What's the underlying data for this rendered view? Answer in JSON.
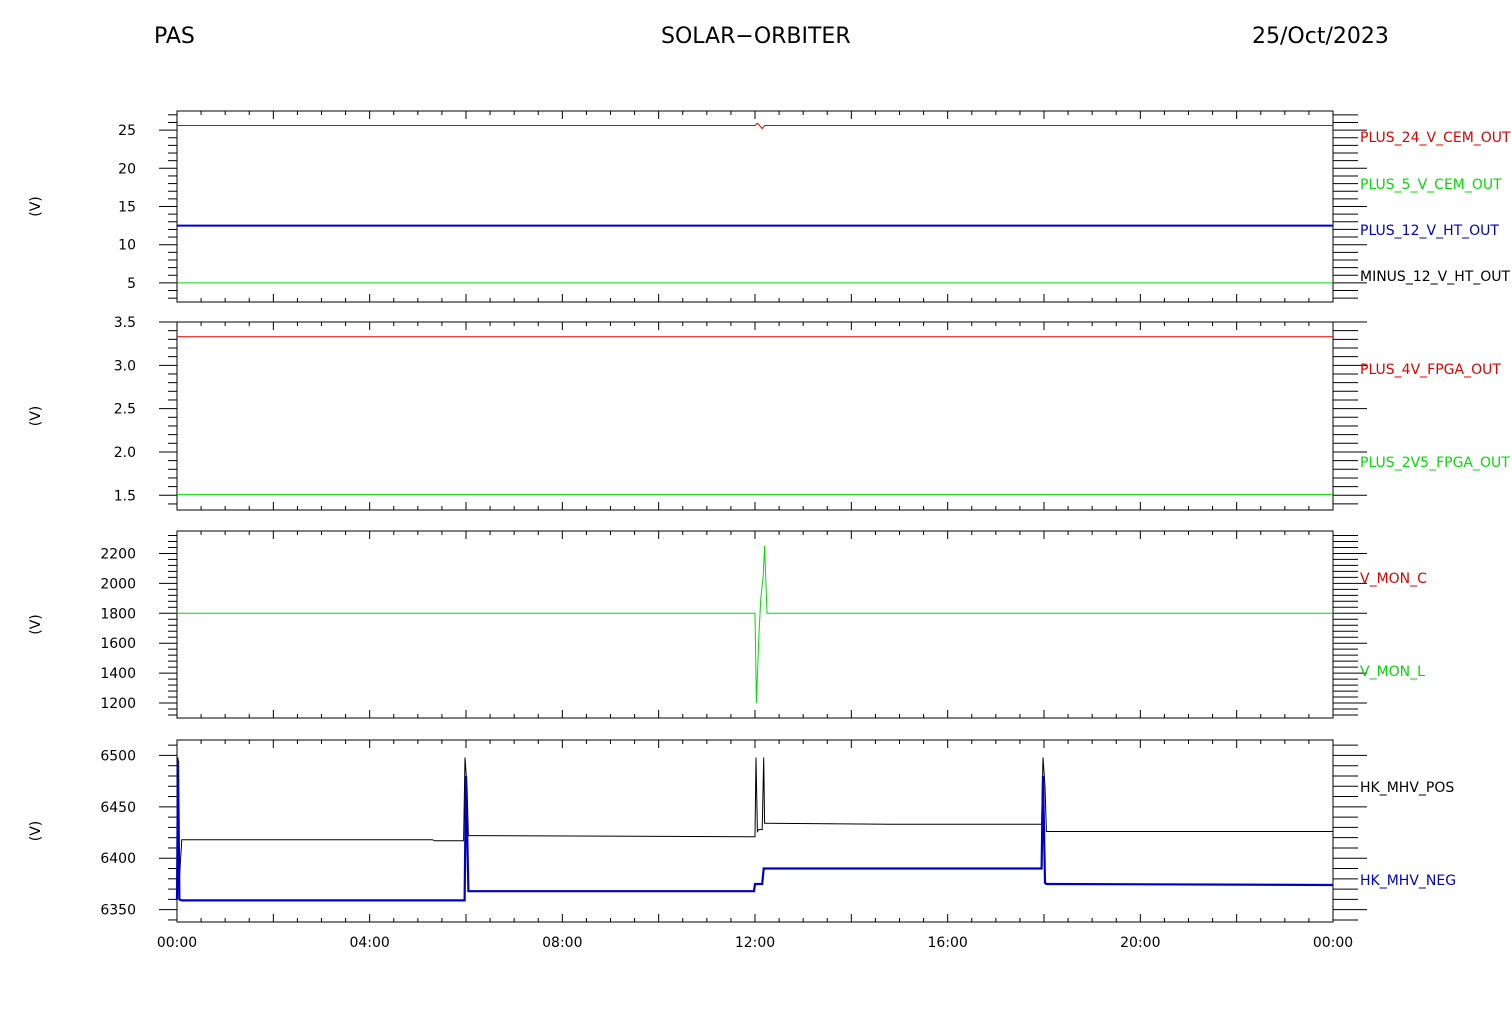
{
  "header": {
    "instrument": "PAS",
    "mission": "SOLAR−ORBITER",
    "date": "25/Oct/2023"
  },
  "colors": {
    "red": "#e00000",
    "green": "#00dd00",
    "blue": "#0000c0",
    "black": "#000000"
  },
  "chart_data": [
    {
      "type": "line",
      "ylabel": "(V)",
      "ylim": [
        2.5,
        27.5
      ],
      "yticks": [
        5,
        10,
        15,
        20,
        25
      ],
      "ytick_labels": [
        "5",
        "10",
        "15",
        "20",
        "25"
      ],
      "xlim": [
        0,
        24
      ],
      "series": [
        {
          "name": "PLUS_24_V_CEM_OUT",
          "color": "#e00000",
          "width": 1,
          "x": [
            0,
            12.0,
            12.05,
            12.15,
            12.2,
            12.3,
            24
          ],
          "y": [
            25.6,
            25.6,
            25.9,
            25.2,
            25.6,
            25.6,
            25.6
          ]
        },
        {
          "name": "PLUS_5_V_CEM_OUT",
          "color": "#00dd00",
          "width": 1,
          "x": [
            0,
            24
          ],
          "y": [
            5.0,
            5.0
          ]
        },
        {
          "name": "PLUS_12_V_HT_OUT",
          "color": "#0000c0",
          "width": 2,
          "x": [
            0,
            24
          ],
          "y": [
            12.5,
            12.5
          ]
        },
        {
          "name": "MINUS_12_V_HT_OUT",
          "color": "#000000",
          "width": 1,
          "x": [],
          "y": []
        }
      ]
    },
    {
      "type": "line",
      "ylabel": "(V)",
      "ylim": [
        1.33,
        3.5
      ],
      "yticks": [
        1.5,
        2.0,
        2.5,
        3.0,
        3.5
      ],
      "ytick_labels": [
        "1.5",
        "2.0",
        "2.5",
        "3.0",
        "3.5"
      ],
      "xlim": [
        0,
        24
      ],
      "series": [
        {
          "name": "PLUS_4V_FPGA_OUT",
          "color": "#e00000",
          "width": 1,
          "x": [
            0,
            24
          ],
          "y": [
            3.33,
            3.33
          ]
        },
        {
          "name": "PLUS_2V5_FPGA_OUT",
          "color": "#00dd00",
          "width": 1,
          "x": [
            0,
            24
          ],
          "y": [
            1.51,
            1.51
          ]
        }
      ]
    },
    {
      "type": "line",
      "ylabel": "(V)",
      "ylim": [
        1100,
        2350
      ],
      "yticks": [
        1200,
        1400,
        1600,
        1800,
        2000,
        2200
      ],
      "ytick_labels": [
        "1200",
        "1400",
        "1600",
        "1800",
        "2000",
        "2200"
      ],
      "xlim": [
        0,
        24
      ],
      "series": [
        {
          "name": "V_MON_C",
          "color": "#e00000",
          "width": 1,
          "x": [],
          "y": []
        },
        {
          "name": "V_MON_L",
          "color": "#00dd00",
          "width": 1,
          "x": [
            0,
            12.0,
            12.03,
            12.08,
            12.12,
            12.17,
            12.2,
            12.25,
            24
          ],
          "y": [
            1800,
            1800,
            1200,
            1650,
            1900,
            2050,
            2250,
            1800,
            1800
          ]
        }
      ]
    },
    {
      "type": "line",
      "ylabel": "(V)",
      "ylim": [
        6338,
        6515
      ],
      "yticks": [
        6350,
        6400,
        6450,
        6500
      ],
      "ytick_labels": [
        "6350",
        "6400",
        "6450",
        "6500"
      ],
      "xlim": [
        0,
        24
      ],
      "xticks": [
        0,
        4,
        8,
        12,
        16,
        20,
        24
      ],
      "xtick_labels": [
        "00:00",
        "04:00",
        "08:00",
        "12:00",
        "16:00",
        "20:00",
        "00:00"
      ],
      "series": [
        {
          "name": "HK_MHV_POS",
          "color": "#000000",
          "width": 1,
          "x": [
            0,
            0.02,
            0.05,
            0.1,
            5.3,
            5.35,
            5.95,
            5.98,
            6.02,
            6.05,
            6.1,
            11.9,
            12.0,
            12.02,
            12.05,
            12.08,
            12.15,
            12.18,
            12.2,
            12.22,
            14.9,
            17.8,
            17.95,
            17.98,
            18.02,
            18.05,
            18.1,
            24
          ],
          "y": [
            6418,
            6498,
            6380,
            6418,
            6418,
            6417,
            6417,
            6498,
            6470,
            6422,
            6422,
            6421,
            6421,
            6498,
            6426,
            6428,
            6428,
            6498,
            6434,
            6434,
            6433,
            6433,
            6433,
            6498,
            6470,
            6426,
            6426,
            6426
          ]
        },
        {
          "name": "HK_MHV_NEG",
          "color": "#0000c0",
          "width": 2.2,
          "x": [
            0,
            0.02,
            0.05,
            0.1,
            5.97,
            6.0,
            6.05,
            6.1,
            11.98,
            12.0,
            12.03,
            12.15,
            12.18,
            12.2,
            17.95,
            17.98,
            18.02,
            18.05,
            18.1,
            24
          ],
          "y": [
            6360,
            6495,
            6360,
            6359,
            6359,
            6480,
            6368,
            6368,
            6368,
            6375,
            6375,
            6375,
            6390,
            6390,
            6390,
            6480,
            6376,
            6375,
            6375,
            6374
          ]
        }
      ]
    }
  ]
}
